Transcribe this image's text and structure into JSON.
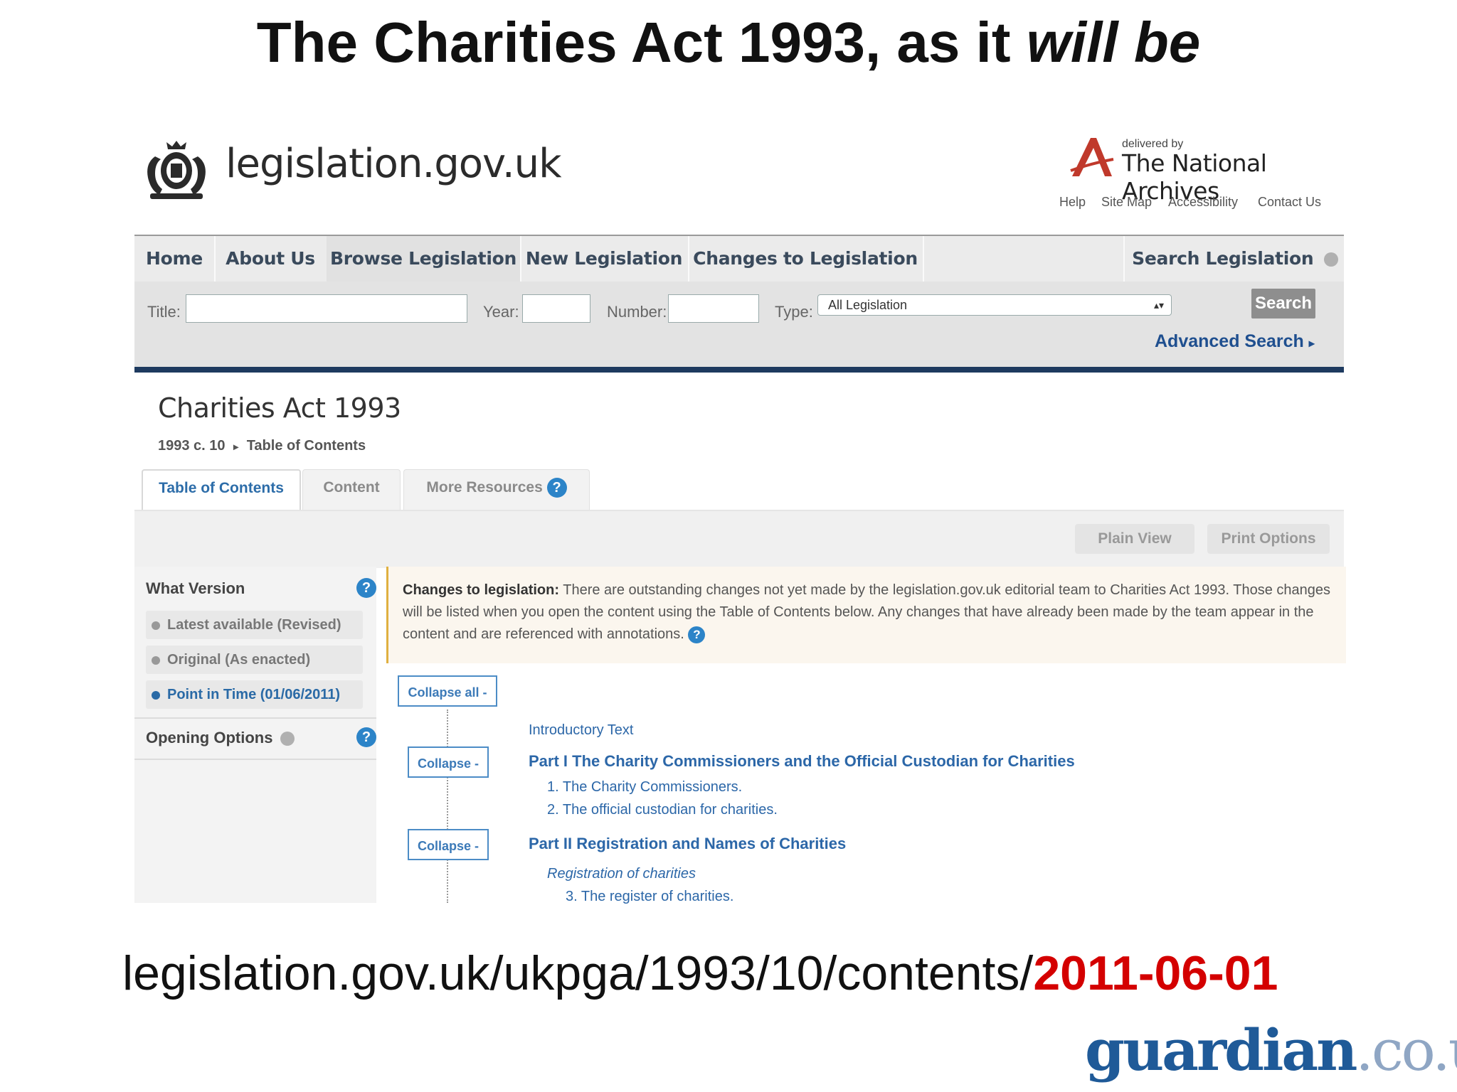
{
  "slide": {
    "title_main": "The Charities Act 1993, as it ",
    "title_emph": "will be",
    "url_prefix": "legislation.gov.uk/ukpga/1993/10/contents/",
    "url_date": "2011-06-01",
    "source_logo": "guardian",
    "source_logo_suffix": ".co.uk"
  },
  "site": {
    "logo_text": "legislation.gov.uk",
    "tna_delivered": "delivered by",
    "tna_name": "The National Archives",
    "top_links": [
      "Help",
      "Site Map",
      "Accessibility",
      "Contact Us"
    ]
  },
  "nav": {
    "items": [
      "Home",
      "About Us",
      "Browse Legislation",
      "New Legislation",
      "Changes to Legislation"
    ],
    "search_legislation": "Search Legislation"
  },
  "search": {
    "title_label": "Title:",
    "title_value": "",
    "year_label": "Year:",
    "year_value": "",
    "number_label": "Number:",
    "number_value": "",
    "type_label": "Type:",
    "type_value": "All Legislation",
    "search_button": "Search",
    "advanced_search": "Advanced Search"
  },
  "document": {
    "title": "Charities Act 1993",
    "breadcrumb_ref": "1993 c. 10",
    "breadcrumb_current": "Table of Contents",
    "tabs": [
      "Table of Contents",
      "Content",
      "More Resources"
    ],
    "view_buttons": [
      "Plain View",
      "Print Options"
    ]
  },
  "sidebar": {
    "what_version": "What Version",
    "versions": [
      "Latest available (Revised)",
      "Original (As enacted)",
      "Point in Time (01/06/2011)"
    ],
    "opening_options": "Opening Options"
  },
  "notice": {
    "heading": "Changes to legislation:",
    "body": " There are outstanding changes not yet made by the legislation.gov.uk editorial team to Charities Act 1993. Those changes will be listed when you open the content using the Table of Contents below. Any changes that have already been made by the team appear in the content and are referenced with annotations."
  },
  "toc": {
    "collapse_all": "Collapse all -",
    "collapse": "Collapse -",
    "intro": "Introductory Text",
    "part1": "Part I The Charity Commissioners and the Official Custodian for Charities",
    "s1": "1.  The Charity Commissioners.",
    "s2": "2.  The official custodian for charities.",
    "part2": "Part II Registration and Names of Charities",
    "sub": "Registration of charities",
    "s3": "3.  The register of charities."
  },
  "colors": {
    "nav_text": "#3a4a5c",
    "link_blue": "#2c67a8",
    "date_red": "#d40000",
    "guardian_blue": "#1f5a98"
  }
}
